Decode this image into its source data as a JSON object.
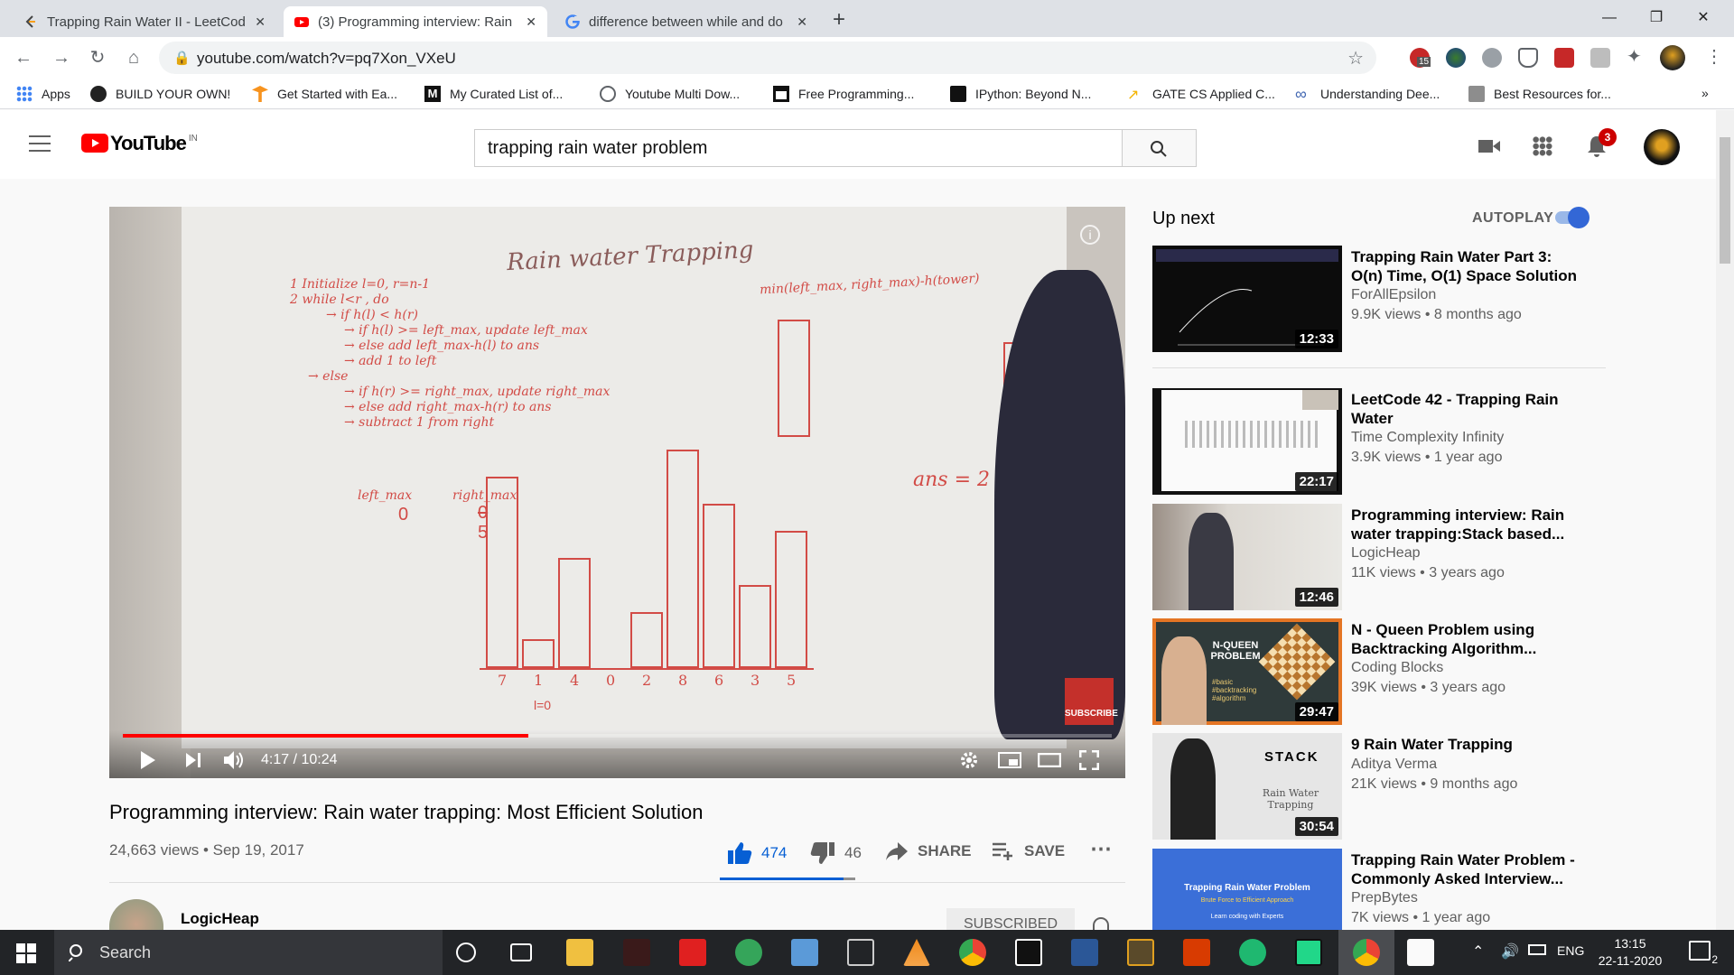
{
  "browser": {
    "tabs": [
      {
        "title": "Trapping Rain Water II - LeetCod",
        "icon": "leetcode-icon",
        "active": false
      },
      {
        "title": "(3) Programming interview: Rain",
        "icon": "youtube-icon",
        "active": true
      },
      {
        "title": "difference between while and do",
        "icon": "google-icon",
        "active": false
      }
    ],
    "url": "youtube.com/watch?v=pq7Xon_VXeU",
    "badge_count": "15",
    "bookmarks": [
      {
        "label": "Apps",
        "icon": "apps-icon"
      },
      {
        "label": "BUILD YOUR OWN!",
        "icon": "github-icon"
      },
      {
        "label": "Get Started with Ea...",
        "icon": "tensorflow-icon"
      },
      {
        "label": "My Curated List of...",
        "icon": "medium-icon"
      },
      {
        "label": "Youtube Multi Dow...",
        "icon": "globe-icon"
      },
      {
        "label": "Free Programming...",
        "icon": "book-icon"
      },
      {
        "label": "IPython: Beyond N...",
        "icon": "ipython-icon"
      },
      {
        "label": "GATE CS Applied C...",
        "icon": "arrow-icon"
      },
      {
        "label": "Understanding Dee...",
        "icon": "infinity-icon"
      },
      {
        "label": "Best Resources for...",
        "icon": "person-icon"
      }
    ],
    "more_bookmarks": "»"
  },
  "youtube": {
    "logo_text": "YouTube",
    "region": "IN",
    "search_query": "trapping rain water problem",
    "notification_count": "3"
  },
  "video": {
    "time_current": "4:17",
    "time_total": "10:24",
    "progress": 0.41,
    "title": "Programming interview: Rain water trapping: Most Efficient Solution",
    "views": "24,663 views",
    "date": "Sep 19, 2017",
    "likes": "474",
    "dislikes": "46",
    "share_label": "SHARE",
    "save_label": "SAVE",
    "channel": "LogicHeap",
    "subscribe_label": "SUBSCRIBED",
    "subscribe_overlay": "SUBSCRIBE"
  },
  "whiteboard": {
    "heading": "Rain water Trapping",
    "lines": [
      "1 Initialize l=0, r=n-1",
      "2 while l<r , do",
      "→ if h(l) < h(r)",
      "→ if h(l) >= left_max, update left_max",
      "→ else add left_max-h(l) to ans",
      "→ add 1 to left",
      "→ else",
      "→ if h(r) >= right_max, update right_max",
      "→ else add right_max-h(r) to ans",
      "→ subtract 1 from right"
    ],
    "formula": "min(left_max, right_max)-h(tower)",
    "left_max": "left_max",
    "left_val": "0",
    "right_max": "right_max",
    "right_val_old": "0",
    "right_val": "5",
    "ans": "ans = 2",
    "bars": [
      7,
      1,
      4,
      0,
      2,
      8,
      6,
      3,
      5
    ],
    "l_label": "l=0"
  },
  "sidebar": {
    "upnext": "Up next",
    "autoplay": "AUTOPLAY",
    "autoplay_on": true,
    "items": [
      {
        "title": "Trapping Rain Water Part 3: O(n) Time, O(1) Space Solution",
        "channel": "ForAllEpsilon",
        "meta": "9.9K views • 8 months ago",
        "duration": "12:33"
      },
      {
        "title": "LeetCode 42 - Trapping Rain Water",
        "channel": "Time Complexity Infinity",
        "meta": "3.9K views • 1 year ago",
        "duration": "22:17"
      },
      {
        "title": "Programming interview: Rain water trapping:Stack based...",
        "channel": "LogicHeap",
        "meta": "11K views • 3 years ago",
        "duration": "12:46"
      },
      {
        "title": "N - Queen Problem using Backtracking Algorithm...",
        "channel": "Coding Blocks",
        "meta": "39K views • 3 years ago",
        "duration": "29:47"
      },
      {
        "title": "9 Rain Water Trapping",
        "channel": "Aditya Verma",
        "meta": "21K views • 9 months ago",
        "duration": "30:54"
      },
      {
        "title": "Trapping Rain Water Problem - Commonly Asked Interview...",
        "channel": "PrepBytes",
        "meta": "7K views • 1 year ago",
        "duration": ""
      }
    ],
    "thumb_text": {
      "nqueen": "N-QUEEN PROBLEM",
      "nqueen_tags": "#basic #backtracking #algorithm",
      "stack": "STACK",
      "stack_sub": "Rain Water Trapping",
      "prep": "Trapping Rain Water Problem",
      "prep_sub": "Brute Force to Efficient Approach",
      "prep_foot": "Learn coding with Experts"
    }
  },
  "taskbar": {
    "search_placeholder": "Search",
    "lang": "ENG",
    "time": "13:15",
    "date": "22-11-2020",
    "notif": "2"
  },
  "colors": {
    "youtube_red": "#ff0000",
    "like_blue": "#065fd4",
    "marker_red": "#d24b46",
    "taskbar": "#222427"
  }
}
